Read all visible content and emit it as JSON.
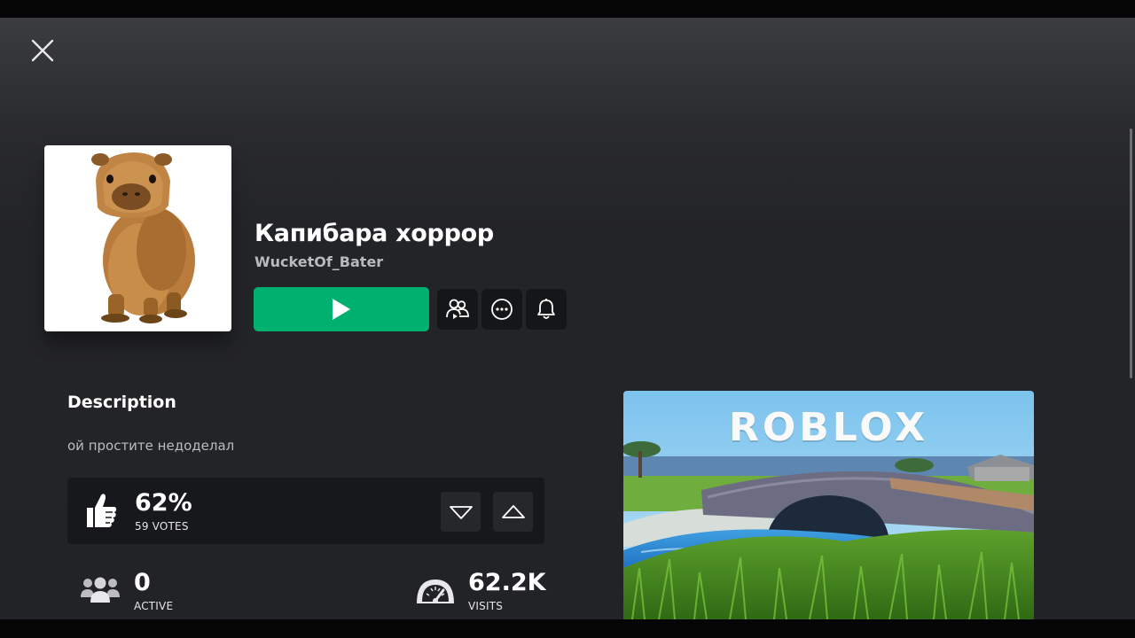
{
  "game": {
    "title": "Капибара хоррор",
    "creator": "WucketOf_Bater"
  },
  "actions": {
    "play": "play-icon",
    "friends": "friends-icon",
    "more": "more-icon",
    "notify": "bell-icon"
  },
  "description": {
    "heading": "Description",
    "text": "ой простите недоделал"
  },
  "votes": {
    "percent": "62%",
    "count": "59 VOTES"
  },
  "stats": {
    "active_value": "0",
    "active_label": "ACTIVE",
    "visits_value": "62.2K",
    "visits_label": "VISITS"
  },
  "screenshot": {
    "logo_text": "ROBLOX"
  },
  "colors": {
    "play_button": "#00b06f",
    "background": "#232427",
    "panel": "#17181b"
  }
}
